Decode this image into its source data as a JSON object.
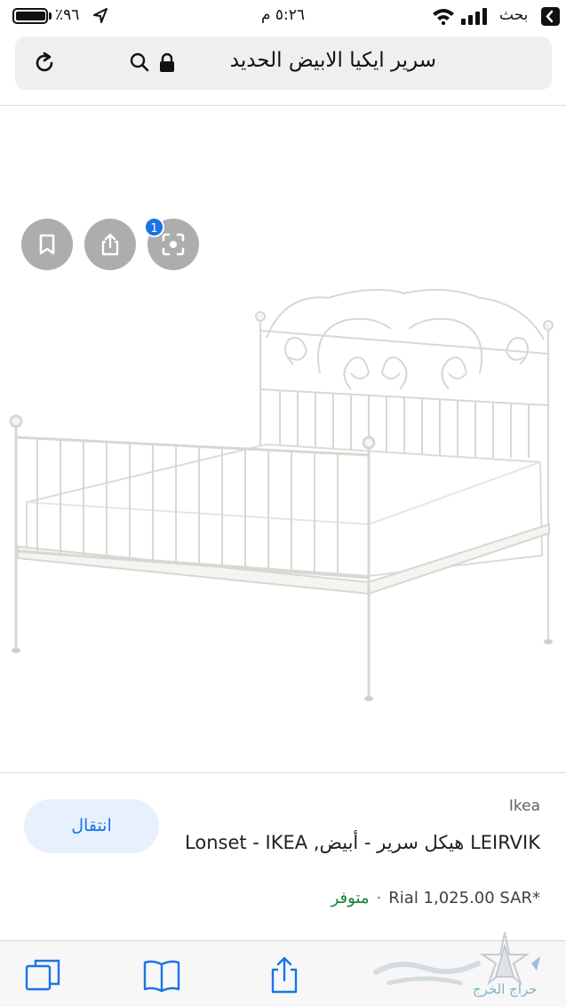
{
  "status_bar": {
    "battery_percent": "٪٩٦",
    "battery_level": 0.96,
    "time": "٥:٢٦ م",
    "carrier": "بحث"
  },
  "address_bar": {
    "query": "سرير ايكيا الابيض الحديد"
  },
  "lens_controls": {
    "badge_count": "1"
  },
  "result": {
    "source": "Ikea",
    "title": "LEIRVIK هيكل سرير - أبيض, Lonset - IKEA",
    "price": "Rial 1,025.00 SAR*",
    "availability": "متوفر",
    "visit_label": "انتقال"
  },
  "colors": {
    "accent_blue": "#1a73e8",
    "visit_bg": "#e8f0fe",
    "availability_green": "#188038"
  },
  "watermark": {
    "text": "حراج الخرج"
  }
}
